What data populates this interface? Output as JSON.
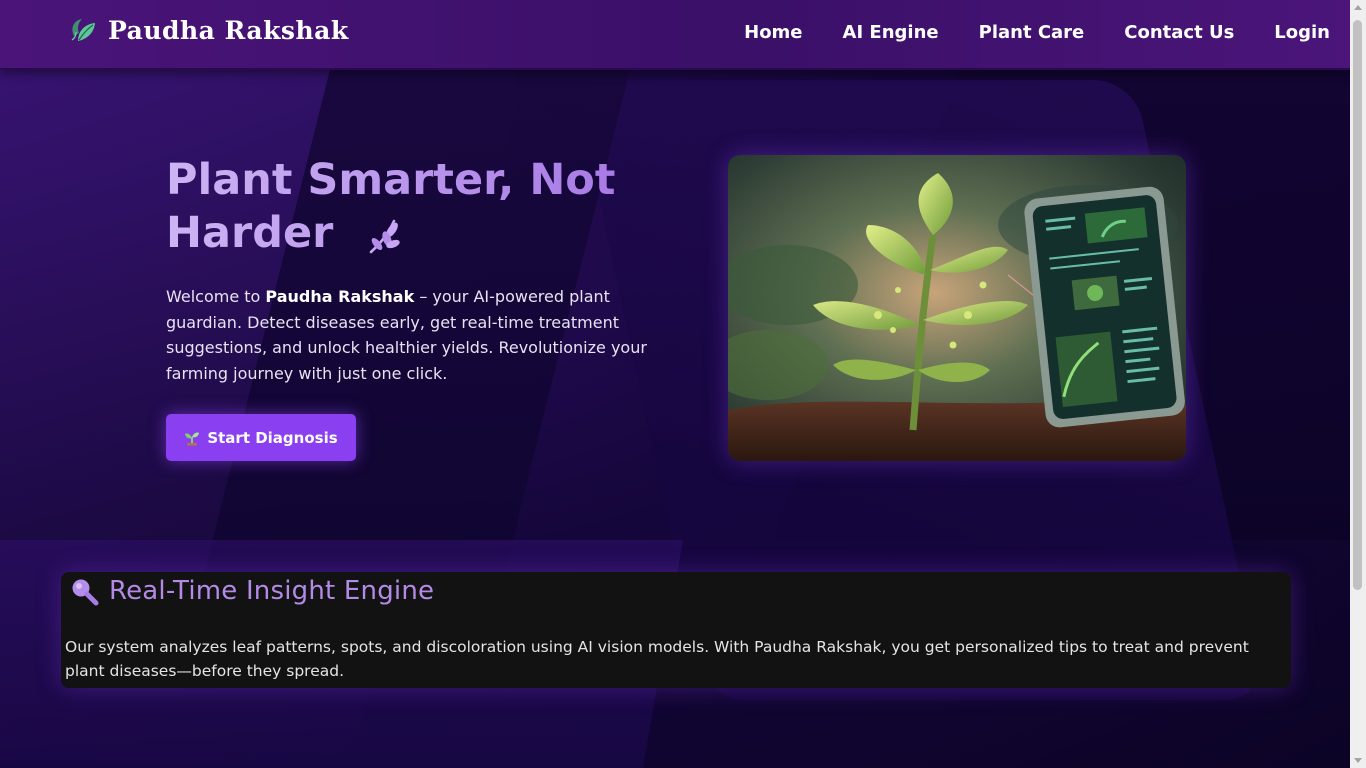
{
  "brand": {
    "name": "Paudha Rakshak"
  },
  "nav": {
    "items": [
      "Home",
      "AI Engine",
      "Plant Care",
      "Contact Us",
      "Login"
    ]
  },
  "hero": {
    "title_line1": "Plant Smarter, Not",
    "title_line2": "Harder",
    "desc_prefix": "Welcome to ",
    "desc_brand": "Paudha Rakshak",
    "desc_suffix": " – your AI-powered plant guardian. Detect diseases early, get real-time treatment suggestions, and unlock healthier yields. Revolutionize your farming journey with just one click.",
    "cta_label": "Start Diagnosis"
  },
  "insight": {
    "title": "Real-Time Insight Engine",
    "text": "Our system analyzes leaf patterns, spots, and discoloration using AI vision models. With Paudha Rakshak, you get personalized tips to treat and prevent plant diseases—before they spread."
  },
  "icons": {
    "logo": "leaf-logo-icon",
    "title_leaf": "herb-leaf-icon",
    "cta": "seedling-icon",
    "insight": "magnifying-glass-icon"
  },
  "colors": {
    "nav_bg": "#3a1068",
    "accent": "#8a3ff0",
    "title_gradient_start": "#cdb4f3",
    "insight_title": "#b38ae6",
    "insight_bg": "#121212"
  }
}
